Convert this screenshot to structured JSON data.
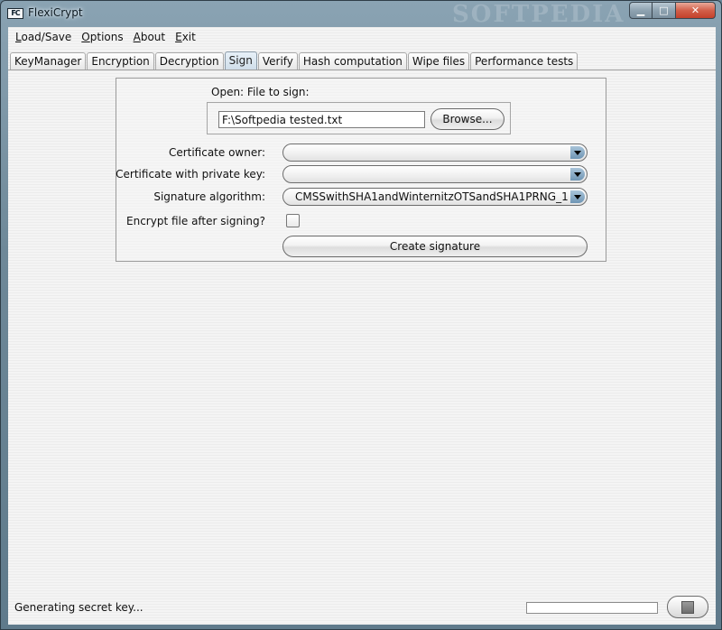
{
  "window": {
    "title": "FlexiCrypt",
    "icon_text": "FC",
    "watermark": "SOFTPEDIA"
  },
  "menu": [
    "Load/Save",
    "Options",
    "About",
    "Exit"
  ],
  "tabs": [
    "KeyManager",
    "Encryption",
    "Decryption",
    "Sign",
    "Verify",
    "Hash computation",
    "Wipe files",
    "Performance tests"
  ],
  "active_tab": "Sign",
  "sign": {
    "open_label": "Open: File to sign:",
    "file_value": "F:\\Softpedia tested.txt",
    "browse_label": "Browse...",
    "certificate_owner_label": "Certificate owner:",
    "certificate_owner_value": "",
    "certificate_private_key_label": "Certificate with private key:",
    "certificate_private_key_value": "",
    "signature_algorithm_label": "Signature algorithm:",
    "signature_algorithm_value": "CMSSwithSHA1andWinternitzOTSandSHA1PRNG_1",
    "encrypt_after_label": "Encrypt file after signing?",
    "encrypt_after_checked": false,
    "create_signature_label": "Create signature"
  },
  "status": {
    "text": "Generating secret key...",
    "progress": 0
  }
}
